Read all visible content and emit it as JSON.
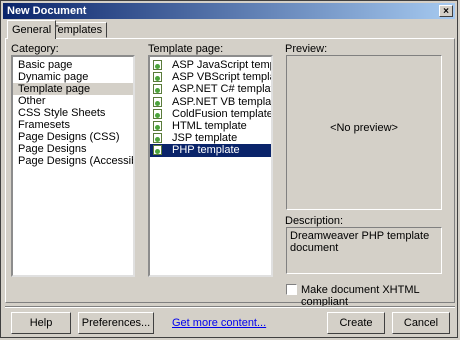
{
  "window": {
    "title": "New Document",
    "close_glyph": "×"
  },
  "tabs": [
    {
      "label": "General",
      "active": true
    },
    {
      "label": "Templates",
      "active": false
    }
  ],
  "category": {
    "label": "Category:",
    "items": [
      "Basic page",
      "Dynamic page",
      "Template page",
      "Other",
      "CSS Style Sheets",
      "Framesets",
      "Page Designs (CSS)",
      "Page Designs",
      "Page Designs (Accessible)"
    ],
    "selected": "Template page"
  },
  "template_page": {
    "label": "Template page:",
    "items": [
      "ASP JavaScript template",
      "ASP VBScript template",
      "ASP.NET C# template",
      "ASP.NET VB template",
      "ColdFusion template",
      "HTML template",
      "JSP template",
      "PHP template"
    ],
    "selected": "PHP template",
    "icon": "template-document-icon"
  },
  "preview": {
    "label": "Preview:",
    "placeholder": "<No preview>"
  },
  "description": {
    "label": "Description:",
    "text": "Dreamweaver PHP template document"
  },
  "xhtml": {
    "label": "Make document XHTML compliant",
    "checked": false
  },
  "buttons": {
    "help": "Help",
    "preferences": "Preferences...",
    "get_more": "Get more content...",
    "create": "Create",
    "cancel": "Cancel"
  },
  "colors": {
    "title_start": "#0a246a",
    "title_end": "#a6caf0",
    "selection": "#0a246a",
    "dialog_bg": "#d4d0c8",
    "link": "#0000ee"
  }
}
